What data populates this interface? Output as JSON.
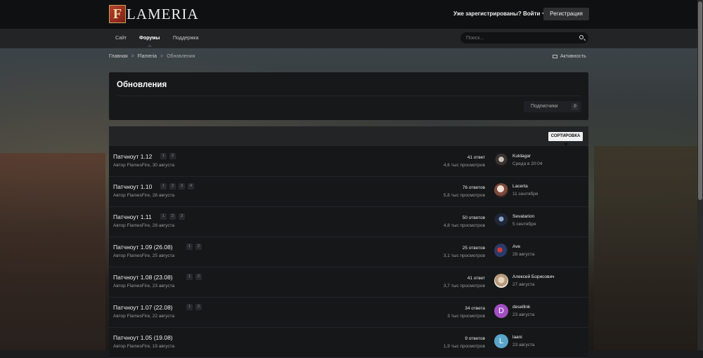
{
  "brand": {
    "logo_letter": "F",
    "logo_rest": "LAMERIA"
  },
  "header": {
    "signin_label": "Уже зарегистрированы? Войти",
    "register_label": "Регистрация"
  },
  "nav": {
    "items": [
      "Сайт",
      "Форумы",
      "Поддержка"
    ],
    "active": "Форумы",
    "search_placeholder": "Поиск..."
  },
  "breadcrumb": {
    "items": [
      "Главная",
      "Flameria",
      "Обновления"
    ],
    "separator": ">"
  },
  "activity_label": "Активность",
  "page": {
    "title": "Обновления",
    "followers_label": "Подписчики",
    "followers_count": "0"
  },
  "list": {
    "sort_label": "СОРТИРОВКА",
    "topics": [
      {
        "title": "Патчноут 1.12",
        "pages": [
          "1",
          "2"
        ],
        "meta": "Автор FlamesFire, 30 августа",
        "replies": "41 ответ",
        "views": "4,6 тыс просмотров",
        "user": "Kuldagar",
        "when": "Среда в 20:04",
        "avatar": ""
      },
      {
        "title": "Патчноут 1.10",
        "pages": [
          "1",
          "2",
          "3",
          "4"
        ],
        "meta": "Автор FlamesFire, 28 августа",
        "replies": "76 ответов",
        "views": "5,8 тыс просмотров",
        "user": "Lacerta",
        "when": "11 сентября",
        "avatar": ""
      },
      {
        "title": "Патчноут 1.11",
        "pages": [
          "1",
          "2",
          "3"
        ],
        "meta": "Автор FlamesFire, 28 августа",
        "replies": "50 ответов",
        "views": "4,8 тыс просмотров",
        "user": "Sevatarion",
        "when": "5 сентября",
        "avatar": ""
      },
      {
        "title": "Патчноут 1.09 (26.08)",
        "pages": [
          "1",
          "2"
        ],
        "meta": "Автор FlamesFire, 25 августа",
        "replies": "25 ответов",
        "views": "3,1 тыс просмотров",
        "user": "Ave",
        "when": "28 августа",
        "avatar": ""
      },
      {
        "title": "Патчноут 1.08 (23.08)",
        "pages": [
          "1",
          "2"
        ],
        "meta": "Автор FlamesFire, 23 августа",
        "replies": "41 ответ",
        "views": "3,7 тыс просмотров",
        "user": "Алексей Борисович",
        "when": "27 августа",
        "avatar": ""
      },
      {
        "title": "Патчноут 1.07 (22.08)",
        "pages": [
          "1",
          "2"
        ],
        "meta": "Автор FlamesFire, 22 августа",
        "replies": "34 ответа",
        "views": "3 тыс просмотров",
        "user": "desellink",
        "when": "23 августа",
        "avatar": "D"
      },
      {
        "title": "Патчноут 1.05 (19.08)",
        "pages": [],
        "meta": "Автор FlamesFire, 19 августа",
        "replies": "9 ответов",
        "views": "1,9 тыс просмотров",
        "user": "laani",
        "when": "23 августа",
        "avatar": "L"
      }
    ]
  },
  "colors": {
    "avatar_d": "#a24fc4",
    "avatar_l": "#5aa5c9",
    "accent": "#ffffff"
  }
}
